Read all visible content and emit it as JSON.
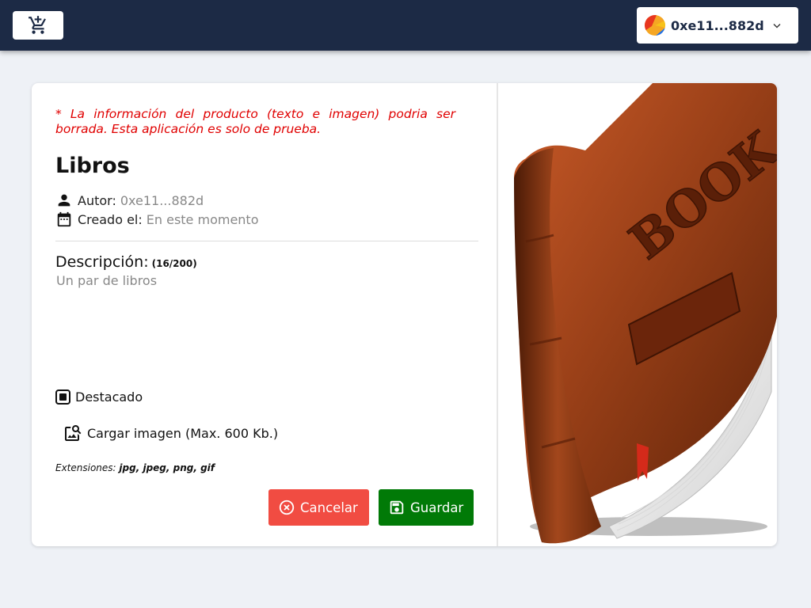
{
  "header": {
    "cart_icon": "add-shopping-cart-icon",
    "wallet": {
      "address": "0xe11...882d",
      "avatar_icon": "identicon-avatar",
      "chevron_icon": "chevron-down-icon"
    }
  },
  "product": {
    "warning": "* La información del producto (texto e imagen) podria ser borrada. Esta aplicación es solo de prueba.",
    "title": "Libros",
    "author_label": "Autor:",
    "author_value": "0xe11...882d",
    "created_label": "Creado el:",
    "created_value": "En este momento",
    "description_label": "Descripción:",
    "description_count": "(16/200)",
    "description_text": "Un par de libros",
    "featured_label": "Destacado",
    "upload_label": "Cargar imagen (Max. 600 Kb.)",
    "extensions_label": "Extensiones:",
    "extensions_value": "jpg, jpeg, png, gif",
    "cancel_label": "Cancelar",
    "save_label": "Guardar",
    "image_text": "BOOK"
  },
  "colors": {
    "topbar": "#1c2a45",
    "background": "#eef1f6",
    "warning": "#e00000",
    "cancel": "#f14c42",
    "save": "#017a07",
    "book": "#8b3a18"
  }
}
